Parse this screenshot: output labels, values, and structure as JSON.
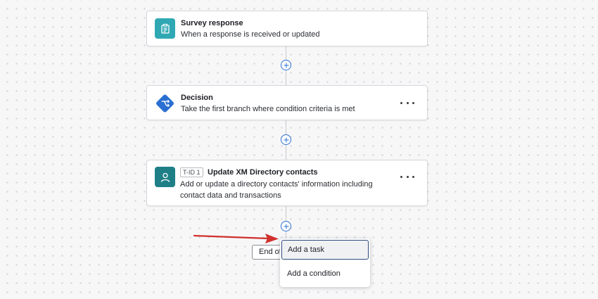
{
  "nodes": [
    {
      "title": "Survey response",
      "description": "When a response is received or updated",
      "icon": "clipboard-icon",
      "icon_color": "#2fa8b3"
    },
    {
      "title": "Decision",
      "description": "Take the first branch where condition criteria is met",
      "icon": "decision-branch-icon",
      "icon_color": "#2a6fd1",
      "more_menu": "more-options-icon"
    },
    {
      "tag": "T-ID 1",
      "title": "Update XM Directory contacts",
      "description_line1": "Add or update a directory contacts' information including",
      "description_line2": "contact data and transactions",
      "icon": "person-icon",
      "icon_color": "#1e7f87",
      "more_menu": "more-options-icon"
    }
  ],
  "end_flow_label": "End of",
  "add_menu": {
    "items": [
      "Add a task",
      "Add a condition"
    ],
    "selected": "Add a task"
  },
  "colors": {
    "accent": "#2a6fd1",
    "annotation_arrow": "#d0312d",
    "menu_selected_border": "#2f4a7c"
  }
}
